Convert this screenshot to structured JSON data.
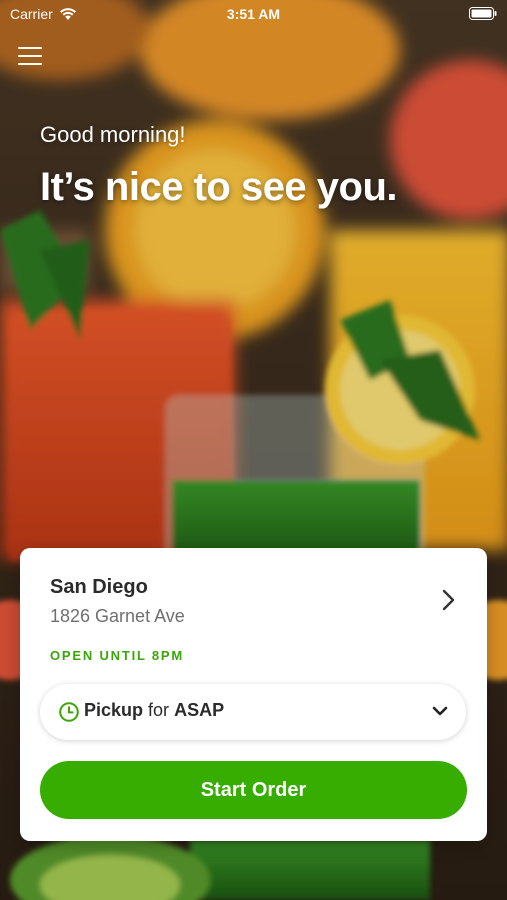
{
  "status_bar": {
    "carrier": "Carrier",
    "time": "3:51 AM"
  },
  "header": {
    "greeting": "Good morning!",
    "headline": "It’s nice to see you."
  },
  "store": {
    "name": "San Diego",
    "address": "1826 Garnet Ave",
    "open_status": "OPEN UNTIL 8PM"
  },
  "order_mode": {
    "method": "Pickup",
    "connector": "for",
    "time": "ASAP"
  },
  "actions": {
    "start_order": "Start Order"
  },
  "colors": {
    "accent": "#36ad00",
    "open_status": "#3aa60a"
  },
  "icons": {
    "menu": "hamburger-menu-icon",
    "chevron_right": "chevron-right-icon",
    "clock": "clock-icon",
    "chevron_down": "chevron-down-icon"
  }
}
